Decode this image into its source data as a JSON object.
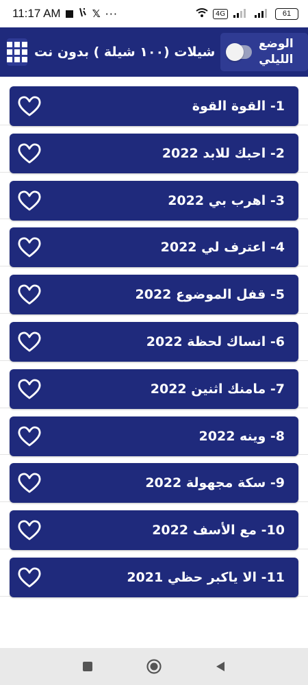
{
  "status_bar": {
    "time": "11:17 AM",
    "x_glyph": "𝕏",
    "dots": "···",
    "data_badge": "4G",
    "battery": "61"
  },
  "header": {
    "title": "شيلات (١٠٠ شيلة ) بدون نت",
    "night_mode_label": "الوضع الليلي",
    "menu_icon": "grid-icon",
    "colors": {
      "primary": "#1f2a7c",
      "card": "#1f2a7c",
      "text": "#ffffff"
    }
  },
  "songs": [
    {
      "title": "1- القوة القوة",
      "icon": "heart-outline-icon"
    },
    {
      "title": "2- احبك للابد 2022",
      "icon": "heart-outline-icon"
    },
    {
      "title": "3- اهرب بي 2022",
      "icon": "heart-outline-icon"
    },
    {
      "title": "4- اعترف لي 2022",
      "icon": "heart-outline-icon"
    },
    {
      "title": "5- قفل الموضوع 2022",
      "icon": "heart-outline-icon"
    },
    {
      "title": "6- انساك لحظة 2022",
      "icon": "heart-outline-icon"
    },
    {
      "title": "7- مامنك اثنين 2022",
      "icon": "heart-outline-icon"
    },
    {
      "title": "8- وينه 2022",
      "icon": "heart-outline-icon"
    },
    {
      "title": "9- سكة مجهولة 2022",
      "icon": "heart-outline-icon"
    },
    {
      "title": "10- مع الأسف 2022",
      "icon": "heart-outline-icon"
    },
    {
      "title": "11- الا ياكبر حظي 2021",
      "icon": "heart-outline-icon"
    }
  ],
  "nav": {
    "buttons": [
      "recents-icon",
      "home-icon",
      "back-icon"
    ]
  }
}
